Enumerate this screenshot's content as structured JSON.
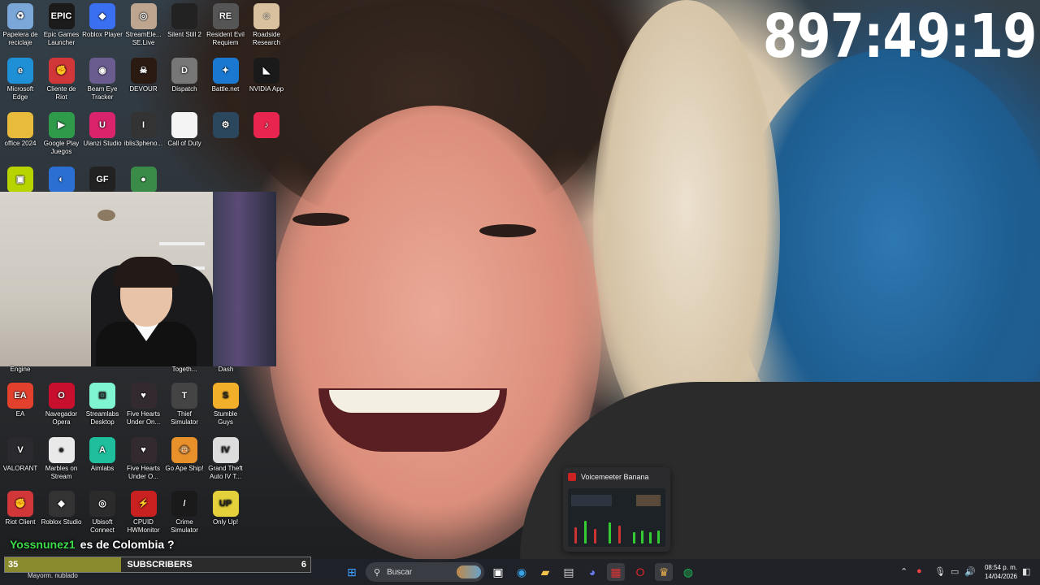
{
  "timer": "897:49:19",
  "desktop_icons_top": [
    {
      "label": "Papelera de reciclaje",
      "icon": "recycle-bin-icon",
      "color": "#7aa7d8",
      "glyph": "♻"
    },
    {
      "label": "Epic Games Launcher",
      "icon": "epic-games-icon",
      "color": "#1b1b1b",
      "glyph": "EPIC"
    },
    {
      "label": "Roblox Player",
      "icon": "roblox-icon",
      "color": "#3a6ff2",
      "glyph": "◆"
    },
    {
      "label": "StreamEle... SE.Live",
      "icon": "streamelements-icon",
      "color": "#bda58f",
      "glyph": "◎"
    },
    {
      "label": "Silent Still 2",
      "icon": "silent-still-icon",
      "color": "#222",
      "glyph": ""
    },
    {
      "label": "Resident Evil Requiem",
      "icon": "resident-evil-icon",
      "color": "#555",
      "glyph": "RE"
    },
    {
      "label": "Roadside Research",
      "icon": "roadside-research-icon",
      "color": "#d9c1a0",
      "glyph": "☺"
    },
    {
      "label": "Microsoft Edge",
      "icon": "edge-icon",
      "color": "#1f8fd6",
      "glyph": "e"
    },
    {
      "label": "Cliente de Riot",
      "icon": "riot-client-icon",
      "color": "#d13639",
      "glyph": "✊"
    },
    {
      "label": "Beam Eye Tracker",
      "icon": "beam-eye-tracker-icon",
      "color": "#6a5c8e",
      "glyph": "◉"
    },
    {
      "label": "DEVOUR",
      "icon": "devour-icon",
      "color": "#2a1a12",
      "glyph": "☠"
    },
    {
      "label": "Dispatch",
      "icon": "dispatch-icon",
      "color": "#777",
      "glyph": "D"
    },
    {
      "label": "Battle.net",
      "icon": "battlenet-icon",
      "color": "#1b78d0",
      "glyph": "✦"
    },
    {
      "label": "NVIDIA App",
      "icon": "nvidia-icon",
      "color": "#1a1a1a",
      "glyph": "◣"
    },
    {
      "label": "office 2024",
      "icon": "folder-icon",
      "color": "#e8bb3c",
      "glyph": ""
    },
    {
      "label": "Google Play Juegos",
      "icon": "google-play-games-icon",
      "color": "#2e9a4a",
      "glyph": "▶"
    },
    {
      "label": "Ulanzi Studio",
      "icon": "ulanzi-studio-icon",
      "color": "#d9236a",
      "glyph": "U"
    },
    {
      "label": "iblis3pheno...",
      "icon": "iblis-icon",
      "color": "#333",
      "glyph": "I"
    },
    {
      "label": "Call of Duty",
      "icon": "file-icon",
      "color": "#f4f4f4",
      "glyph": ""
    },
    {
      "label": "",
      "icon": "steam-icon",
      "color": "#2a475e",
      "glyph": "⚙"
    },
    {
      "label": "",
      "icon": "tiktok-icon",
      "color": "#e8254e",
      "glyph": "♪"
    },
    {
      "label": "",
      "icon": "yellow-square-icon",
      "color": "#b7d400",
      "glyph": "▣"
    },
    {
      "label": "",
      "icon": "rocket-league-icon",
      "color": "#2a6fd1",
      "glyph": "◐"
    },
    {
      "label": "",
      "icon": "gone-fishing-icon",
      "color": "#222",
      "glyph": "GF"
    },
    {
      "label": "",
      "icon": "game-icon",
      "color": "#3a8b48",
      "glyph": "●"
    }
  ],
  "desktop_icons_bottom": [
    {
      "label": "Engine",
      "icon": "",
      "color": "",
      "glyph": ""
    },
    {
      "label": "Togeth...",
      "icon": "",
      "color": "",
      "glyph": ""
    },
    {
      "label": "Dash",
      "icon": "",
      "color": "",
      "glyph": ""
    },
    {
      "label": "EA",
      "icon": "ea-icon",
      "color": "#e4402e",
      "glyph": "EA"
    },
    {
      "label": "Navegador Opera",
      "icon": "opera-icon",
      "color": "#c8102e",
      "glyph": "O"
    },
    {
      "label": "Streamlabs Desktop",
      "icon": "streamlabs-icon",
      "color": "#80f5d2",
      "glyph": "⊡"
    },
    {
      "label": "Five Hearts Under On...",
      "icon": "five-hearts-icon",
      "color": "#332a2f",
      "glyph": "♥"
    },
    {
      "label": "Thief Simulator",
      "icon": "thief-simulator-icon",
      "color": "#444",
      "glyph": "T"
    },
    {
      "label": "Stumble Guys",
      "icon": "stumble-guys-icon",
      "color": "#f2b02a",
      "glyph": "S"
    },
    {
      "label": "VALORANT",
      "icon": "valorant-icon",
      "color": "#2a2a2e",
      "glyph": "V"
    },
    {
      "label": "Marbles on Stream",
      "icon": "marbles-icon",
      "color": "#e9e9e9",
      "glyph": "●"
    },
    {
      "label": "Aimlabs",
      "icon": "aimlabs-icon",
      "color": "#1fbf9d",
      "glyph": "A"
    },
    {
      "label": "Five Hearts Under O...",
      "icon": "five-hearts-icon",
      "color": "#332a2f",
      "glyph": "♥"
    },
    {
      "label": "Go Ape Ship!",
      "icon": "go-ape-ship-icon",
      "color": "#e8902a",
      "glyph": "🐵"
    },
    {
      "label": "Grand Theft Auto IV T...",
      "icon": "gta-iv-icon",
      "color": "#ddd",
      "glyph": "IV"
    },
    {
      "label": "Riot Client",
      "icon": "riot-client-icon",
      "color": "#d13639",
      "glyph": "✊"
    },
    {
      "label": "Roblox Studio",
      "icon": "roblox-studio-icon",
      "color": "#333",
      "glyph": "◆"
    },
    {
      "label": "Ubisoft Connect",
      "icon": "ubisoft-icon",
      "color": "#2b2b2b",
      "glyph": "◎"
    },
    {
      "label": "CPUID HWMonitor",
      "icon": "hwmonitor-icon",
      "color": "#c92020",
      "glyph": "⚡"
    },
    {
      "label": "Crime Simulator",
      "icon": "crime-simulator-icon",
      "color": "#1a1a1a",
      "glyph": "/"
    },
    {
      "label": "Only Up!",
      "icon": "only-up-icon",
      "color": "#e3d03a",
      "glyph": "UP"
    }
  ],
  "chat": {
    "user": "Yossnunez1",
    "message": "es de Colombia ?"
  },
  "subscriber_bar": {
    "current": "35",
    "label": "SUBSCRIBERS",
    "goal": "6",
    "fill_fraction": 0.38
  },
  "taskbar": {
    "weather": "Mayorm. nublado",
    "search_placeholder": "Buscar",
    "pinned_icons": [
      "windows-start-icon",
      "task-view-icon",
      "edge-icon",
      "file-explorer-icon",
      "store-icon",
      "discord-icon",
      "voicemeeter-icon",
      "opera-icon",
      "streamlabs-icon",
      "spotify-icon"
    ],
    "time": "08:54 p. m.",
    "date": "14/04/2026"
  },
  "preview": {
    "title": "Voicemeeter Banana"
  },
  "colors": {
    "timer": "#ffffff",
    "chat_user": "#3ddc4a",
    "bar_fill": "#8a8a2f",
    "taskbar": "#202228"
  }
}
